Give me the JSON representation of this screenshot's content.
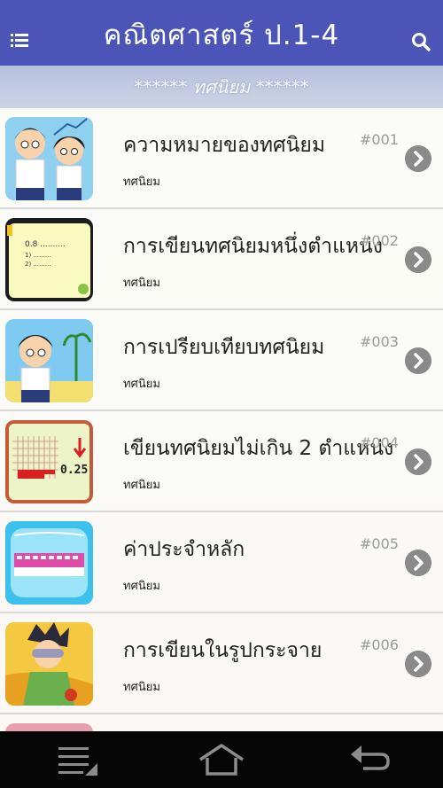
{
  "header": {
    "title": "คณิตศาสตร์ ป.1-4",
    "subtitle": "****** ทศนิยม ******",
    "menu_icon": "menu-icon",
    "search_icon": "search-icon",
    "colors": {
      "bar": "#4b55b8",
      "subbar": "#c2cae2"
    }
  },
  "lessons": [
    {
      "title": "ความหมายของทศนิยม",
      "number": "#001",
      "category": "ทศนิยม"
    },
    {
      "title": "การเขียนทศนิยมหนึ่งตำแหน่ง",
      "number": "#002",
      "category": "ทศนิยม"
    },
    {
      "title": "การเปรียบเทียบทศนิยม",
      "number": "#003",
      "category": "ทศนิยม"
    },
    {
      "title": "เขียนทศนิยมไม่เกิน 2 ตำแหน่ง",
      "number": "#004",
      "category": "ทศนิยม"
    },
    {
      "title": "ค่าประจำหลัก",
      "number": "#005",
      "category": "ทศนิยม"
    },
    {
      "title": "การเขียนในรูปกระจาย",
      "number": "#006",
      "category": "ทศนิยม"
    }
  ],
  "thumb4_text": "0.25",
  "navbar": {
    "recent_icon": "recent-apps-icon",
    "home_icon": "home-icon",
    "back_icon": "back-icon"
  }
}
